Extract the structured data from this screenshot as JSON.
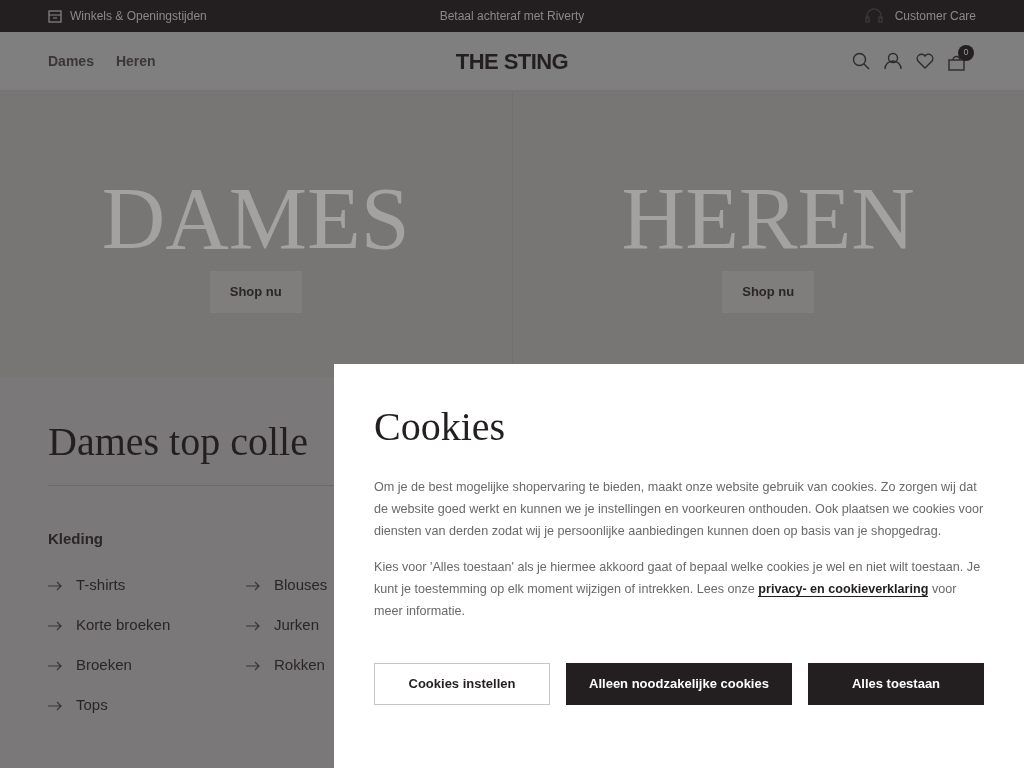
{
  "top_bar": {
    "left": "Winkels & Openingstijden",
    "center": "Betaal achteraf met Riverty",
    "right": "Customer Care"
  },
  "nav": {
    "links": [
      "Dames",
      "Heren"
    ],
    "logo": "THE STING",
    "cart_count": "0"
  },
  "hero": [
    {
      "title": "DAMES",
      "button": "Shop nu"
    },
    {
      "title": "HEREN",
      "button": "Shop nu"
    }
  ],
  "collection": {
    "title": "Dames top colle",
    "section": "Kleding",
    "columns": [
      [
        "T-shirts",
        "Korte broeken",
        "Broeken",
        "Tops"
      ],
      [
        "Blouses",
        "Jurken",
        "Rokken"
      ]
    ]
  },
  "cookie_dialog": {
    "title": "Cookies",
    "paragraph_1": "Om je de best mogelijke shopervaring te bieden, maakt onze website gebruik van cookies. Zo zorgen wij dat de website goed werkt en kunnen we je instellingen en voorkeuren onthouden. Ook plaatsen we cookies voor diensten van derden zodat wij je persoonlijke aanbiedingen kunnen doen op basis van je shopgedrag.",
    "paragraph_2": "Kies voor 'Alles toestaan' als je hiermee akkoord gaat of bepaal welke cookies je wel en niet wilt toestaan. Je kunt je toestemming op elk moment wijzigen of intrekken. Lees onze",
    "link": "privacy- en cookieverklaring",
    "paragraph_2_end": "voor meer informatie.",
    "buttons": [
      {
        "label": "Cookies instellen",
        "kind": "outline"
      },
      {
        "label": "Alleen noodzakelijke cookies",
        "kind": "solid"
      },
      {
        "label": "Alles toestaan",
        "kind": "solid"
      }
    ]
  }
}
